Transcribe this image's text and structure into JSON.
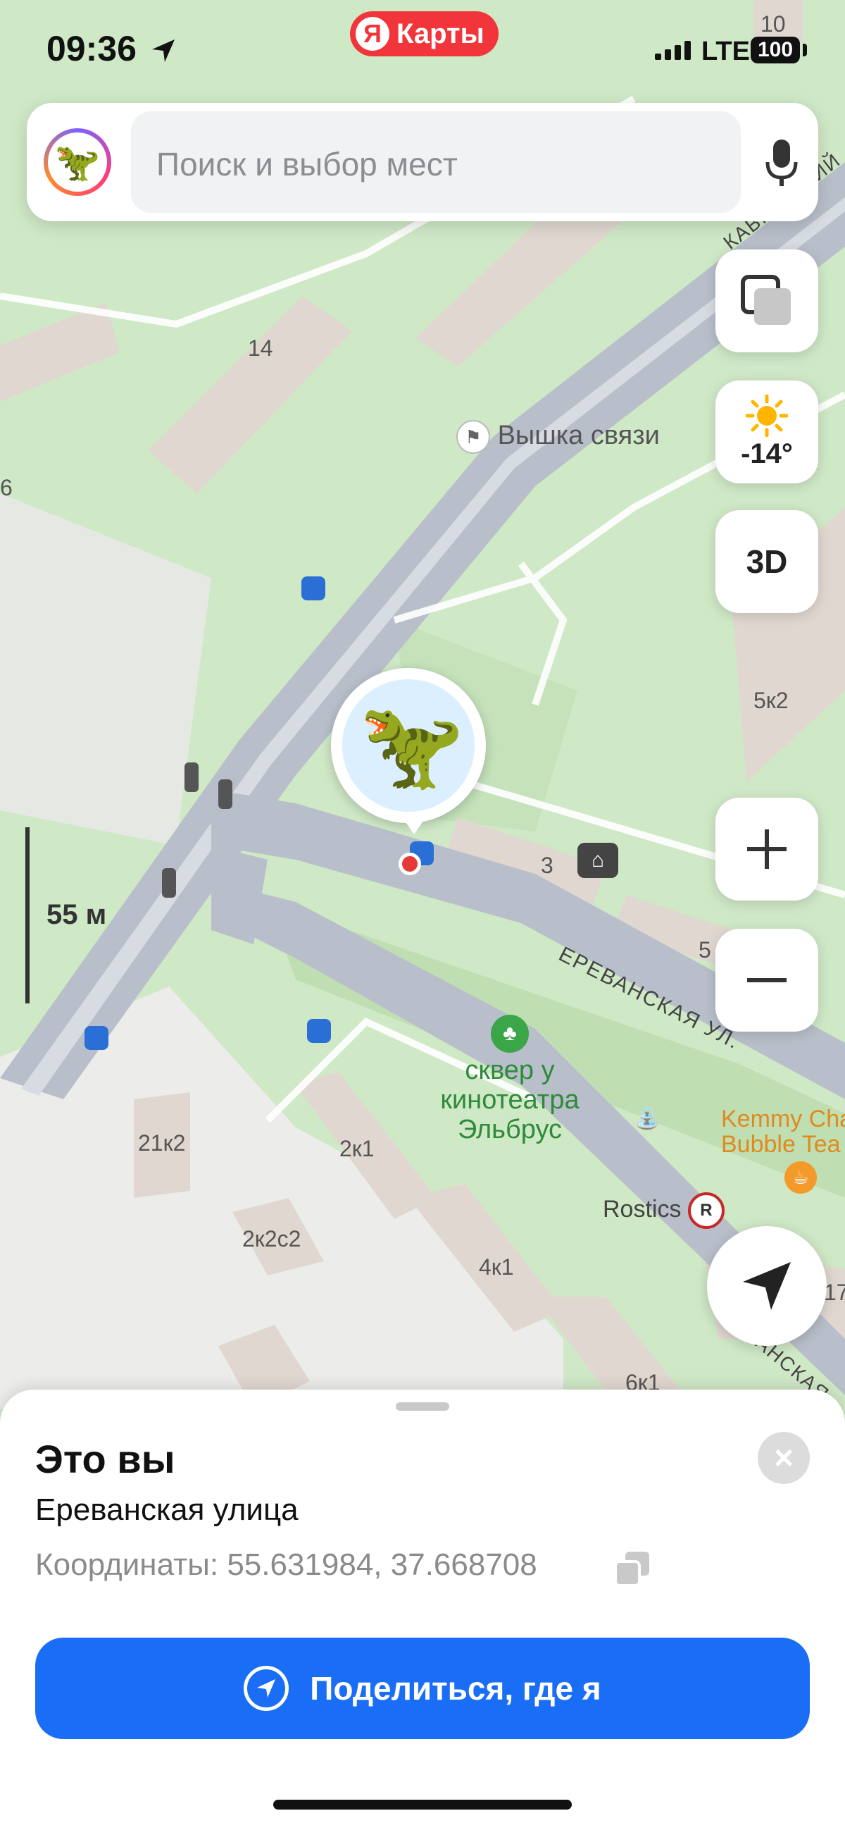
{
  "status_bar": {
    "time": "09:36",
    "brand": "Карты",
    "network": "LTE",
    "battery": "100"
  },
  "search": {
    "placeholder": "Поиск и выбор мест",
    "avatar_emoji": "🦖"
  },
  "controls": {
    "weather_temp": "-14°",
    "mode_3d_label": "3D",
    "zoom_in": "+",
    "zoom_out": "−"
  },
  "scale": {
    "label": "55 м"
  },
  "map_labels": {
    "tower": "Вышка связи",
    "park_line1": "сквер у",
    "park_line2": "кинотеатра",
    "park_line3": "Эльбрус",
    "street_name": "ЕРЕВАНСКАЯ УЛ.",
    "street_name_2": "ЕРЕВАНСКАЯ",
    "kavkaz": "КАВКАЗСКИЙ",
    "cafe_line1": "Kemmy Cha",
    "cafe_line2": "Bubble Tea",
    "rostics": "Rostics",
    "b14": "14",
    "b10": "10",
    "b6": "6",
    "b5k2": "5к2",
    "b3": "3",
    "b5": "5",
    "b21k2": "21к2",
    "b2k1": "2к1",
    "b2k2c2": "2к2с2",
    "b4k1": "4к1",
    "b6k1": "6к1",
    "b17": "17"
  },
  "location_pin": {
    "emoji": "🦖"
  },
  "sheet": {
    "title": "Это вы",
    "street": "Ереванская улица",
    "coordinates": "Координаты: 55.631984, 37.668708",
    "share_button": "Поделиться, где я",
    "close_symbol": "×"
  },
  "colors": {
    "accent": "#1a6ef5",
    "brand": "#f2343b",
    "map_green": "#cfe8c6",
    "road": "#b9bfca"
  }
}
